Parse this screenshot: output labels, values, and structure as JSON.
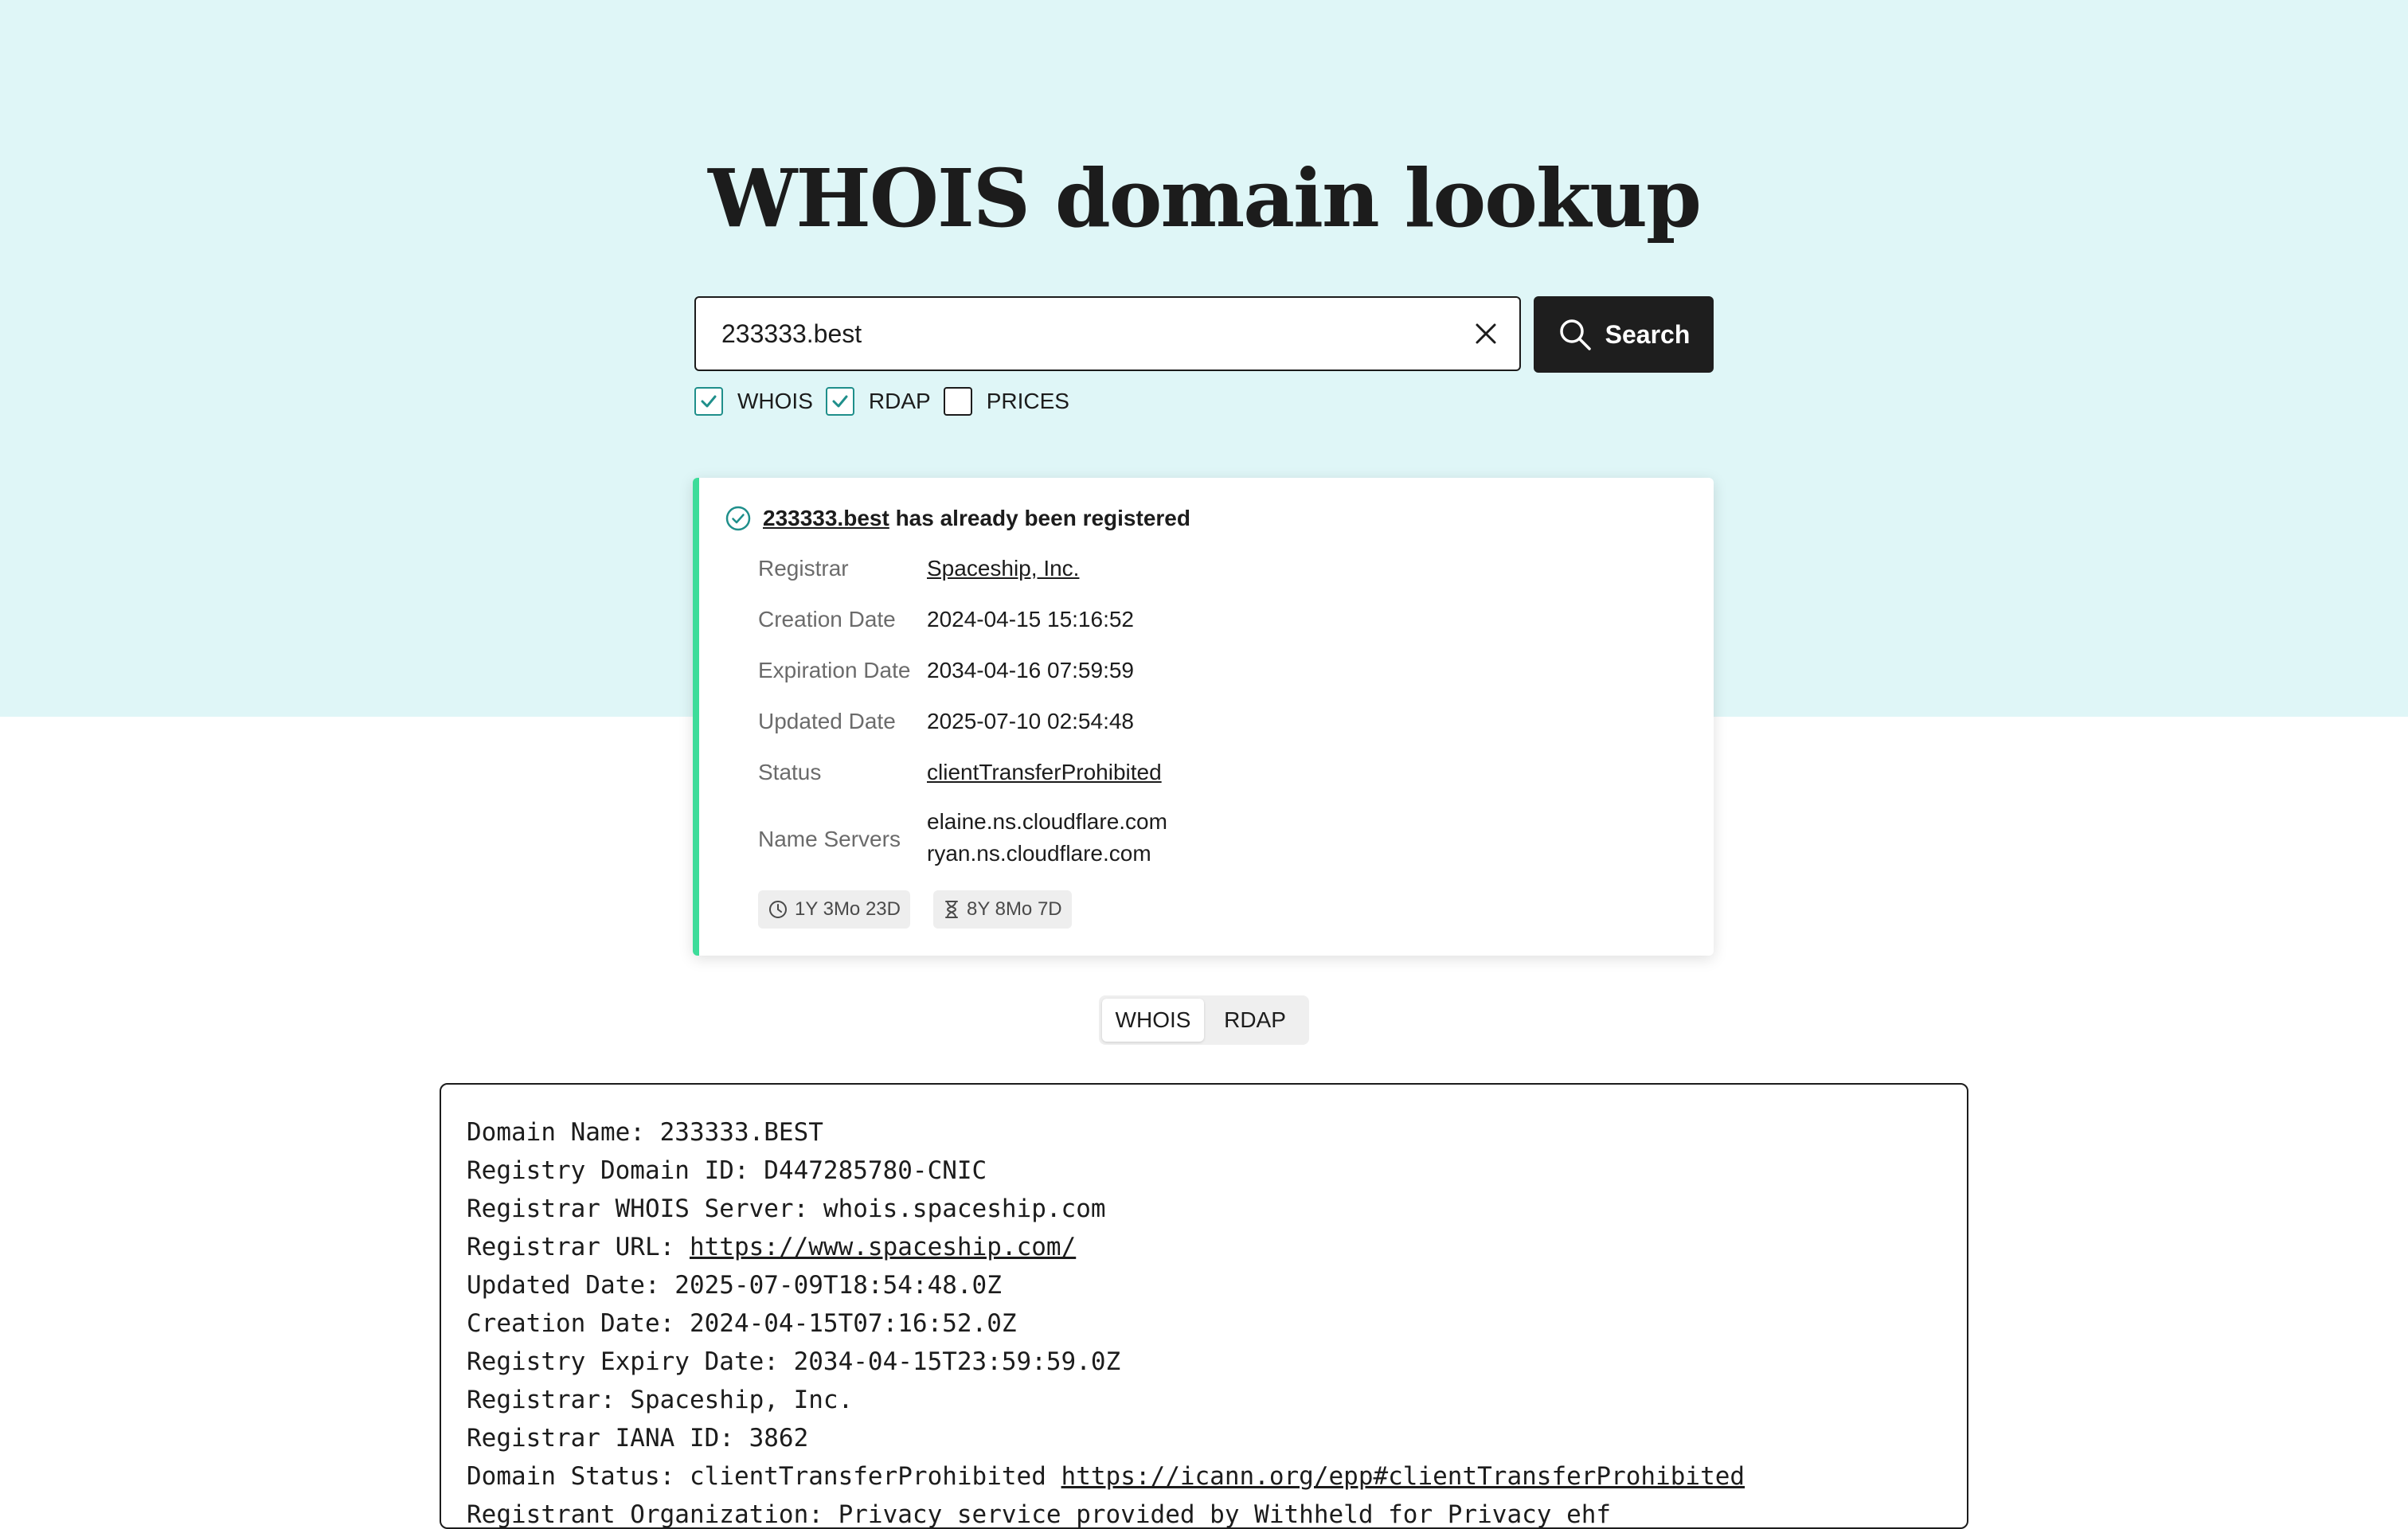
{
  "header": {
    "title": "WHOIS domain lookup"
  },
  "search": {
    "value": "233333.best",
    "button_label": "Search"
  },
  "options": [
    {
      "label": "WHOIS",
      "checked": true
    },
    {
      "label": "RDAP",
      "checked": true
    },
    {
      "label": "PRICES",
      "checked": false
    }
  ],
  "result": {
    "domain": "233333.best",
    "message": "has already been registered",
    "accent_color": "#3ddc9a",
    "rows": [
      {
        "label": "Registrar",
        "value": "Spaceship, Inc."
      },
      {
        "label": "Creation Date",
        "value": "2024-04-15 15:16:52"
      },
      {
        "label": "Expiration Date",
        "value": "2034-04-16 07:59:59"
      },
      {
        "label": "Updated Date",
        "value": "2025-07-10 02:54:48"
      },
      {
        "label": "Status",
        "value": "clientTransferProhibited"
      },
      {
        "label": "Name Servers",
        "values": [
          "elaine.ns.cloudflare.com",
          "ryan.ns.cloudflare.com"
        ]
      }
    ],
    "badges": [
      {
        "icon": "clock-icon",
        "text": "1Y 3Mo 23D"
      },
      {
        "icon": "hourglass-icon",
        "text": "8Y 8Mo 7D"
      }
    ]
  },
  "tabs": [
    {
      "label": "WHOIS",
      "active": true
    },
    {
      "label": "RDAP",
      "active": false
    }
  ],
  "raw": {
    "lines": [
      {
        "text": "Domain Name: 233333.BEST"
      },
      {
        "text": "Registry Domain ID: D447285780-CNIC"
      },
      {
        "text": "Registrar WHOIS Server: whois.spaceship.com"
      },
      {
        "text": "Registrar URL: ",
        "link": "https://www.spaceship.com/"
      },
      {
        "text": "Updated Date: 2025-07-09T18:54:48.0Z"
      },
      {
        "text": "Creation Date: 2024-04-15T07:16:52.0Z"
      },
      {
        "text": "Registry Expiry Date: 2034-04-15T23:59:59.0Z"
      },
      {
        "text": "Registrar: Spaceship, Inc."
      },
      {
        "text": "Registrar IANA ID: 3862"
      },
      {
        "text": "Domain Status: clientTransferProhibited ",
        "link": "https://icann.org/epp#clientTransferProhibited"
      },
      {
        "text": "Registrant Organization: Privacy service provided by Withheld for Privacy ehf"
      }
    ]
  }
}
